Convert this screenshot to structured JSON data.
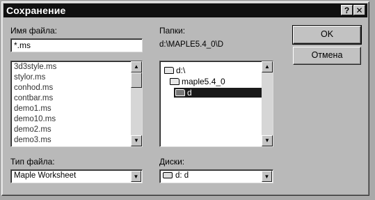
{
  "dialog": {
    "title": "Сохранение",
    "help_button": "?",
    "close_button": "✕"
  },
  "file_name": {
    "label": "Имя файла:",
    "value": "*.ms",
    "files": [
      "3d3style.ms",
      "stylor.ms",
      "conhod.ms",
      "contbar.ms",
      "demo1.ms",
      "demo10.ms",
      "demo2.ms",
      "demo3.ms"
    ]
  },
  "folders": {
    "label": "Папки:",
    "current_path": "d:\\MAPLE5.4_0\\D",
    "tree": [
      {
        "name": "d:\\",
        "selected": false
      },
      {
        "name": "maple5.4_0",
        "selected": false
      },
      {
        "name": "d",
        "selected": true
      }
    ]
  },
  "buttons": {
    "ok": "OK",
    "cancel": "Отмена"
  },
  "file_type": {
    "label": "Тип файла:",
    "value": "Maple Worksheet"
  },
  "drives": {
    "label": "Диски:",
    "value": "d: d"
  }
}
